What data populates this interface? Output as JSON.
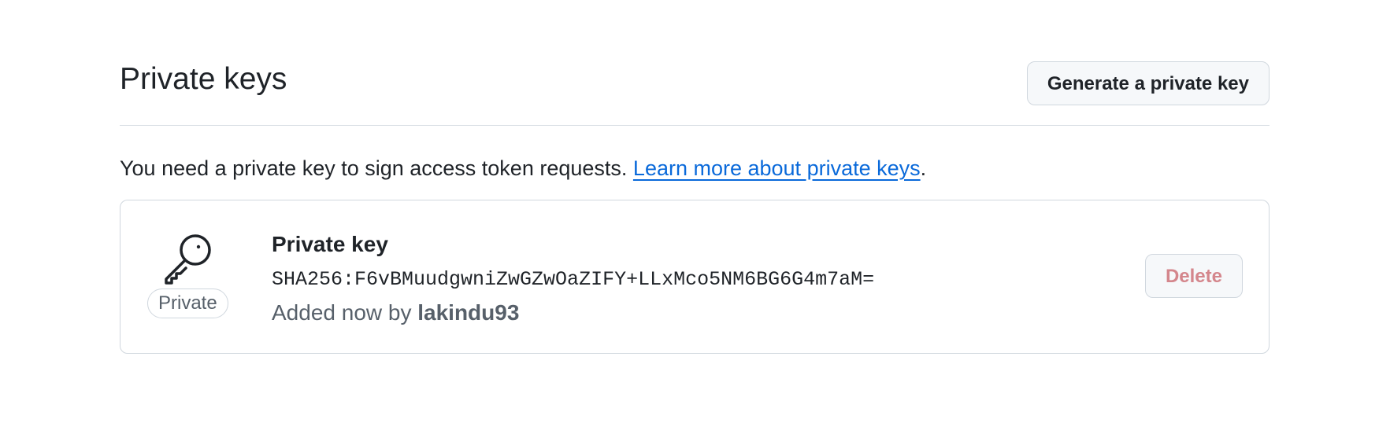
{
  "section": {
    "title": "Private keys",
    "generate_button_label": "Generate a private key"
  },
  "description": {
    "text": "You need a private key to sign access token requests.",
    "link_text": "Learn more about private keys",
    "trailing": "."
  },
  "key": {
    "icon": "key-icon",
    "badge": "Private",
    "name": "Private key",
    "fingerprint": "SHA256:F6vBMuudgwniZwGZwOaZIFY+LLxMco5NM6BG6G4m7aM=",
    "added_prefix": "Added now by",
    "added_by": "lakindu93",
    "delete_button_label": "Delete"
  },
  "colors": {
    "link": "#0969da",
    "danger_disabled": "#d4868c",
    "border": "#d0d7de",
    "muted_text": "#57606a"
  }
}
